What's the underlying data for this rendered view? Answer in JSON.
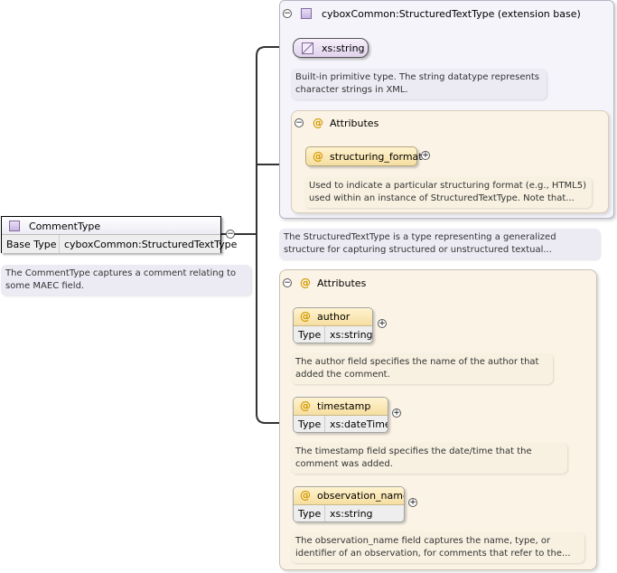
{
  "extension": {
    "title": "cyboxCommon:StructuredTextType (extension base)",
    "string_label": "xs:string",
    "string_doc": "Built-in primitive type. The string datatype represents character strings in XML.",
    "attributes_label": "Attributes",
    "structuring_format": {
      "name": "structuring_format",
      "doc": "Used to indicate a particular structuring format (e.g., HTML5) used within an instance of StructuredTextType. Note that..."
    },
    "doc": "The StructuredTextType is a type representing a generalized structure for capturing structured or unstructured textual..."
  },
  "comment_type": {
    "title": "CommentType",
    "base_label": "Base Type",
    "base_value": "cyboxCommon:StructuredTextType",
    "doc": "The CommentType captures a comment relating to some MAEC field."
  },
  "attributes": {
    "label": "Attributes",
    "type_label": "Type",
    "items": [
      {
        "name": "author",
        "type": "xs:string",
        "doc": "The author field specifies the name of the author that added the comment."
      },
      {
        "name": "timestamp",
        "type": "xs:dateTime",
        "doc": "The timestamp field specifies the date/time that the comment was added."
      },
      {
        "name": "observation_name",
        "type": "xs:string",
        "doc": "The observation_name field captures the name, type, or identifier of an observation, for comments that refer to the..."
      }
    ]
  },
  "icons": {
    "minus": "−",
    "plus": "+",
    "at": "@"
  },
  "colors": {
    "type_fill": "#d8c8ea",
    "attr_fill": "#f6dea1",
    "panel_cream": "#fbf4e6",
    "panel_lavender": "#f4f4fa"
  }
}
